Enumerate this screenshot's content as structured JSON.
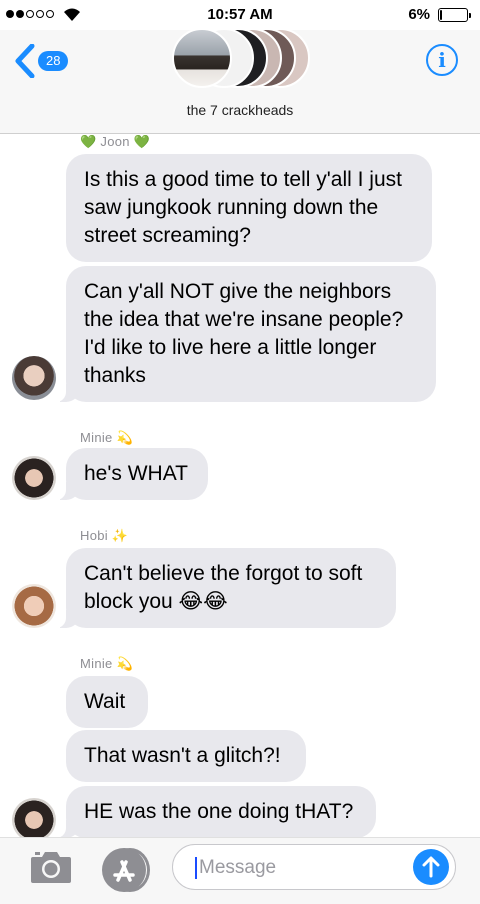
{
  "status_bar": {
    "time": "10:57 AM",
    "battery_percent": "6%",
    "battery_level": 0.06,
    "signal_full": 2,
    "signal_total": 5
  },
  "header": {
    "back_badge": "28",
    "group_name": "the 7 crackheads",
    "info_glyph": "i"
  },
  "messages": {
    "sender_1": "💚 Joon 💚",
    "m1": "Is this a good time to tell y'all I just saw jungkook running down the street screaming?",
    "m2": "Can y'all NOT give the neighbors the idea that we're insane people? I'd like to live here a little longer thanks",
    "sender_2": "Minie 💫",
    "m3": "he's WHAT",
    "sender_3": "Hobi ✨",
    "m4": "Can't believe the forgot to soft block you 😂😂",
    "sender_4": "Minie 💫",
    "m5": "Wait",
    "m6": "That wasn't a glitch?!",
    "m7": "HE was the one doing tHAT?"
  },
  "input": {
    "placeholder": "Message"
  },
  "colors": {
    "accent": "#1a8cff",
    "bubble": "#e8e8ed",
    "header_bg": "#f7f7f7"
  },
  "icons": [
    "back-chevron-icon",
    "info-icon",
    "camera-icon",
    "app-store-icon",
    "send-arrow-icon"
  ]
}
